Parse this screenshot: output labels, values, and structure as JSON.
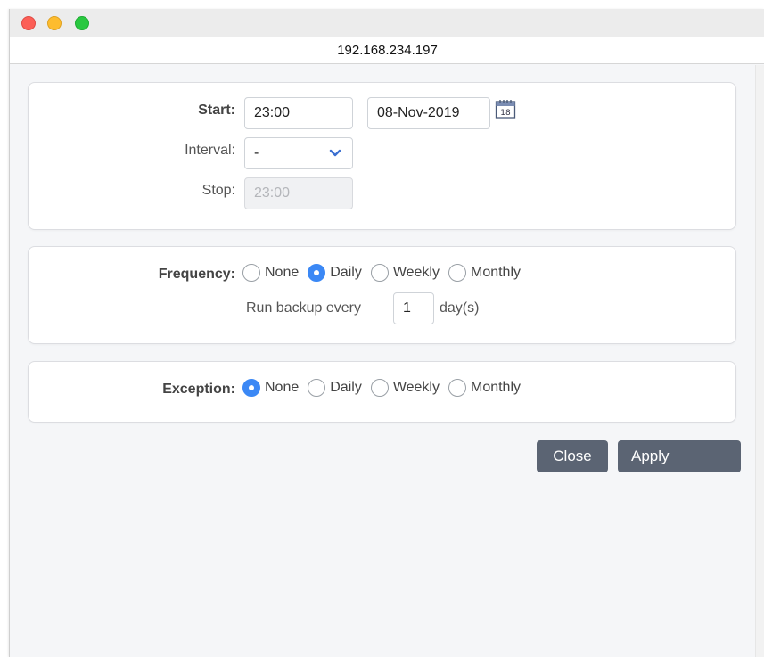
{
  "window": {
    "address": "192.168.234.197"
  },
  "schedule": {
    "start_label": "Start:",
    "start_time": "23:00",
    "start_date": "08-Nov-2019",
    "interval_label": "Interval:",
    "interval_value": "-",
    "stop_label": "Stop:",
    "stop_value": "23:00"
  },
  "frequency": {
    "label": "Frequency:",
    "options": [
      "None",
      "Daily",
      "Weekly",
      "Monthly"
    ],
    "selected": "Daily",
    "run_prefix": "Run backup every",
    "run_value": "1",
    "run_suffix": "day(s)"
  },
  "exception": {
    "label": "Exception:",
    "options": [
      "None",
      "Daily",
      "Weekly",
      "Monthly"
    ],
    "selected": "None"
  },
  "buttons": {
    "close": "Close",
    "apply": "Apply"
  },
  "colors": {
    "accent": "#3b88f5",
    "button": "#5b6473"
  },
  "icons": {
    "calendar": "calendar-icon",
    "interval_dropdown": "chevron-down-icon"
  }
}
